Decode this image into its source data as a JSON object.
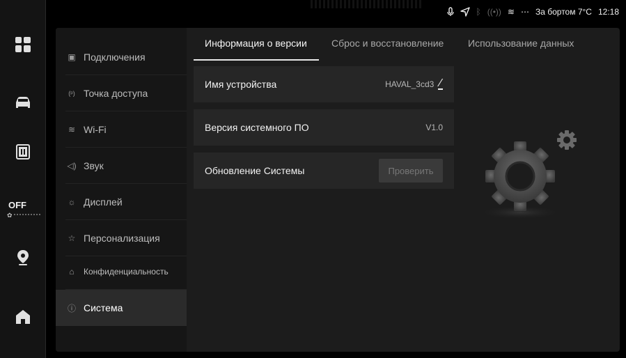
{
  "status_bar": {
    "icons": [
      "microphone-icon",
      "navigation-icon",
      "bluetooth-icon",
      "hotspot-icon",
      "wifi-icon"
    ],
    "temperature_text": "За бортом 7°C",
    "time": "12:18"
  },
  "dock": {
    "items": [
      "apps-grid-icon",
      "car-icon",
      "media-icon",
      "climate-off",
      "location-pin-icon",
      "home-icon"
    ],
    "climate_label": "OFF"
  },
  "sidebar": {
    "items": [
      {
        "label": "Подключения",
        "icon": "connection-icon"
      },
      {
        "label": "Точка доступа",
        "icon": "hotspot-icon"
      },
      {
        "label": "Wi-Fi",
        "icon": "wifi-icon"
      },
      {
        "label": "Звук",
        "icon": "sound-icon"
      },
      {
        "label": "Дисплей",
        "icon": "brightness-icon"
      },
      {
        "label": "Персонализация",
        "icon": "personalize-icon"
      },
      {
        "label": "Конфиденциальность",
        "icon": "lock-icon"
      },
      {
        "label": "Система",
        "icon": "info-icon"
      }
    ],
    "active_index": 7
  },
  "tabs": [
    {
      "label": "Информация о версии",
      "active": true
    },
    {
      "label": "Сброс и восстановление",
      "active": false
    },
    {
      "label": "Использование данных",
      "active": false
    }
  ],
  "rows": {
    "device_name": {
      "label": "Имя устройства",
      "value": "HAVAL_3cd3"
    },
    "firmware": {
      "label": "Версия системного ПО",
      "value": "V1.0"
    },
    "update": {
      "label": "Обновление Системы",
      "button": "Проверить"
    }
  },
  "colors": {
    "background": "#000000",
    "panel": "#1c1c1c",
    "sidebar": "#161616",
    "row": "#262626",
    "active_item": "#2b2b2b",
    "text_primary": "#f2f2f2",
    "text_secondary": "#a8a8a8"
  }
}
